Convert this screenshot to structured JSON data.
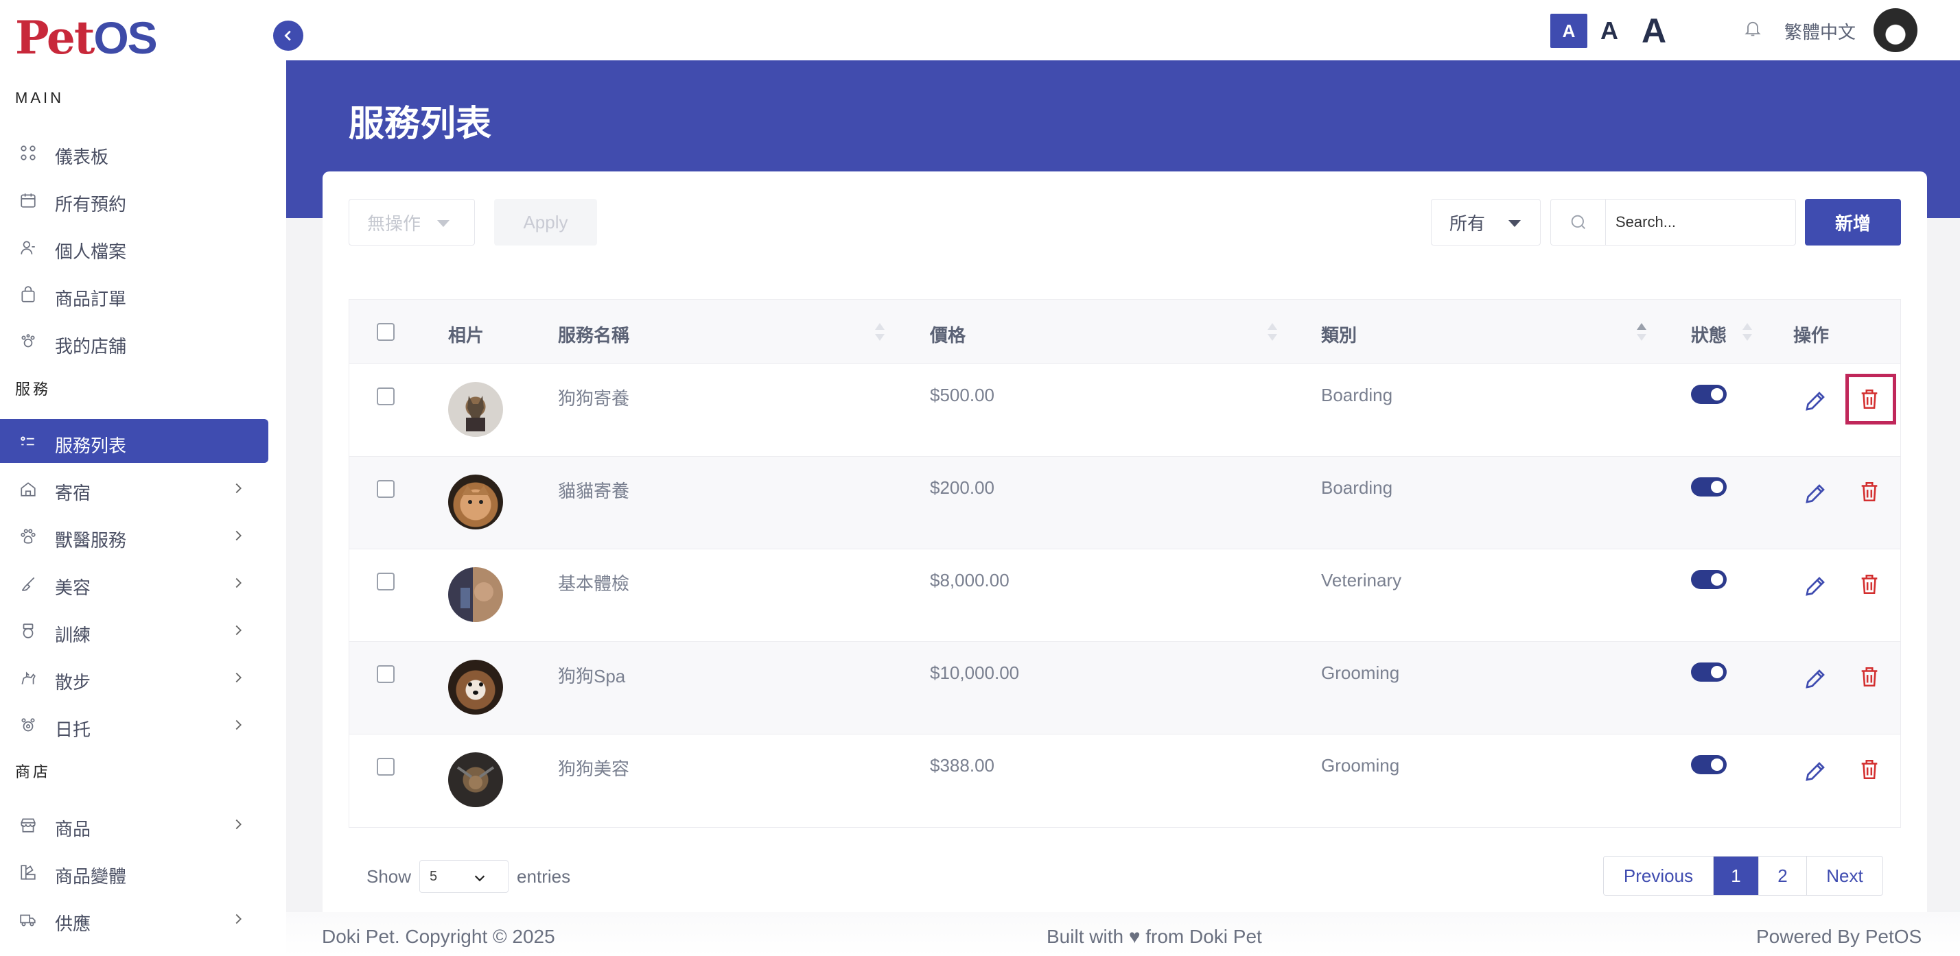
{
  "app": {
    "logo_p": "Pet",
    "logo_os": "OS"
  },
  "topbar": {
    "font_small": "A",
    "font_mid": "A",
    "font_big": "A",
    "language": "繁體中文"
  },
  "sidebar": {
    "section_main": "MAIN",
    "section_service": "服務",
    "section_shop": "商店",
    "main_items": [
      {
        "label": "儀表板",
        "icon": "grid-icon"
      },
      {
        "label": "所有預約",
        "icon": "calendar-icon"
      },
      {
        "label": "個人檔案",
        "icon": "user-icon"
      },
      {
        "label": "商品訂單",
        "icon": "bag-icon"
      },
      {
        "label": "我的店舖",
        "icon": "store-icon"
      }
    ],
    "service_items": [
      {
        "label": "服務列表",
        "icon": "list-icon"
      },
      {
        "label": "寄宿",
        "icon": "home-icon"
      },
      {
        "label": "獸醫服務",
        "icon": "paw-icon"
      },
      {
        "label": "美容",
        "icon": "brush-icon"
      },
      {
        "label": "訓練",
        "icon": "medal-icon"
      },
      {
        "label": "散步",
        "icon": "dog-icon"
      },
      {
        "label": "日托",
        "icon": "daycare-icon"
      }
    ],
    "shop_items": [
      {
        "label": "商品",
        "icon": "shop-icon"
      },
      {
        "label": "商品變體",
        "icon": "variant-icon"
      },
      {
        "label": "供應",
        "icon": "truck-icon"
      }
    ]
  },
  "page": {
    "title": "服務列表"
  },
  "toolbar": {
    "bulk_action": "無操作",
    "apply_label": "Apply",
    "filter_value": "所有",
    "search_placeholder": "Search...",
    "add_label": "新增"
  },
  "table": {
    "headers": {
      "photo": "相片",
      "name": "服務名稱",
      "price": "價格",
      "category": "類別",
      "status": "狀態",
      "actions": "操作"
    },
    "rows": [
      {
        "name": "狗狗寄養",
        "price": "$500.00",
        "category": "Boarding",
        "enabled": true
      },
      {
        "name": "貓貓寄養",
        "price": "$200.00",
        "category": "Boarding",
        "enabled": true
      },
      {
        "name": "基本體檢",
        "price": "$8,000.00",
        "category": "Veterinary",
        "enabled": true
      },
      {
        "name": "狗狗Spa",
        "price": "$10,000.00",
        "category": "Grooming",
        "enabled": true
      },
      {
        "name": "狗狗美容",
        "price": "$388.00",
        "category": "Grooming",
        "enabled": true
      }
    ]
  },
  "pagination": {
    "show_label": "Show",
    "entries_value": "5",
    "entries_label": "entries",
    "previous": "Previous",
    "page1": "1",
    "page2": "2",
    "next": "Next"
  },
  "footer": {
    "brand": "Doki Pet",
    "copyright": ". Copyright © 2025",
    "built_pre": "Built with ",
    "heart": "♥",
    "built_post": " from Doki Pet",
    "powered_pre": "Powered By ",
    "powered_brand": "PetOS"
  },
  "colors": {
    "primary": "#3f4cb0",
    "danger": "#d32f2f",
    "highlight": "#c0275a"
  }
}
